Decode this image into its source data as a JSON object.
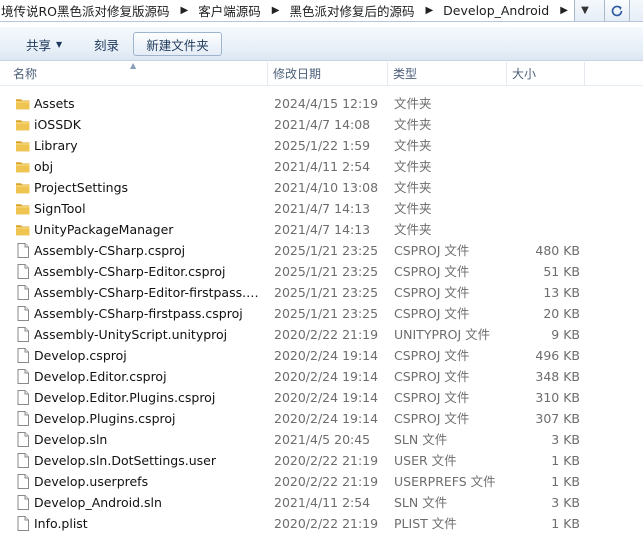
{
  "address_bar": {
    "breadcrumbs": [
      "境传说RO黑色派对修复版源码",
      "客户端源码",
      "黑色派对修复后的源码",
      "Develop_Android"
    ],
    "separator_icon": "chevron-right-icon",
    "refresh_icon": "refresh-icon"
  },
  "command_bar": {
    "share_label": "共享",
    "burn_label": "刻录",
    "new_folder_label": "新建文件夹"
  },
  "columns": {
    "name": "名称",
    "date": "修改日期",
    "type": "类型",
    "size": "大小",
    "sorted_by": "name"
  },
  "colors": {
    "folder": "#e8b83c",
    "accent": "#1e395b"
  },
  "files": [
    {
      "name": "Assets",
      "date": "2024/4/15 12:19",
      "type": "文件夹",
      "size": "",
      "icon": "folder-icon"
    },
    {
      "name": "iOSSDK",
      "date": "2021/4/7 14:08",
      "type": "文件夹",
      "size": "",
      "icon": "folder-icon"
    },
    {
      "name": "Library",
      "date": "2025/1/22 1:59",
      "type": "文件夹",
      "size": "",
      "icon": "folder-icon"
    },
    {
      "name": "obj",
      "date": "2021/4/11 2:54",
      "type": "文件夹",
      "size": "",
      "icon": "folder-icon"
    },
    {
      "name": "ProjectSettings",
      "date": "2021/4/10 13:08",
      "type": "文件夹",
      "size": "",
      "icon": "folder-icon"
    },
    {
      "name": "SignTool",
      "date": "2021/4/7 14:13",
      "type": "文件夹",
      "size": "",
      "icon": "folder-icon"
    },
    {
      "name": "UnityPackageManager",
      "date": "2021/4/7 14:13",
      "type": "文件夹",
      "size": "",
      "icon": "folder-icon"
    },
    {
      "name": "Assembly-CSharp.csproj",
      "date": "2025/1/21 23:25",
      "type": "CSPROJ 文件",
      "size": "480 KB",
      "icon": "file-icon"
    },
    {
      "name": "Assembly-CSharp-Editor.csproj",
      "date": "2025/1/21 23:25",
      "type": "CSPROJ 文件",
      "size": "51 KB",
      "icon": "file-icon"
    },
    {
      "name": "Assembly-CSharp-Editor-firstpass.cs...",
      "date": "2025/1/21 23:25",
      "type": "CSPROJ 文件",
      "size": "13 KB",
      "icon": "file-icon"
    },
    {
      "name": "Assembly-CSharp-firstpass.csproj",
      "date": "2025/1/21 23:25",
      "type": "CSPROJ 文件",
      "size": "20 KB",
      "icon": "file-icon"
    },
    {
      "name": "Assembly-UnityScript.unityproj",
      "date": "2020/2/22 21:19",
      "type": "UNITYPROJ 文件",
      "size": "9 KB",
      "icon": "file-icon"
    },
    {
      "name": "Develop.csproj",
      "date": "2020/2/24 19:14",
      "type": "CSPROJ 文件",
      "size": "496 KB",
      "icon": "file-icon"
    },
    {
      "name": "Develop.Editor.csproj",
      "date": "2020/2/24 19:14",
      "type": "CSPROJ 文件",
      "size": "348 KB",
      "icon": "file-icon"
    },
    {
      "name": "Develop.Editor.Plugins.csproj",
      "date": "2020/2/24 19:14",
      "type": "CSPROJ 文件",
      "size": "310 KB",
      "icon": "file-icon"
    },
    {
      "name": "Develop.Plugins.csproj",
      "date": "2020/2/24 19:14",
      "type": "CSPROJ 文件",
      "size": "307 KB",
      "icon": "file-icon"
    },
    {
      "name": "Develop.sln",
      "date": "2021/4/5 20:45",
      "type": "SLN 文件",
      "size": "3 KB",
      "icon": "file-icon"
    },
    {
      "name": "Develop.sln.DotSettings.user",
      "date": "2020/2/22 21:19",
      "type": "USER 文件",
      "size": "1 KB",
      "icon": "file-icon"
    },
    {
      "name": "Develop.userprefs",
      "date": "2020/2/22 21:19",
      "type": "USERPREFS 文件",
      "size": "1 KB",
      "icon": "file-icon"
    },
    {
      "name": "Develop_Android.sln",
      "date": "2021/4/11 2:54",
      "type": "SLN 文件",
      "size": "3 KB",
      "icon": "file-icon"
    },
    {
      "name": "Info.plist",
      "date": "2020/2/22 21:19",
      "type": "PLIST 文件",
      "size": "1 KB",
      "icon": "file-icon"
    }
  ]
}
